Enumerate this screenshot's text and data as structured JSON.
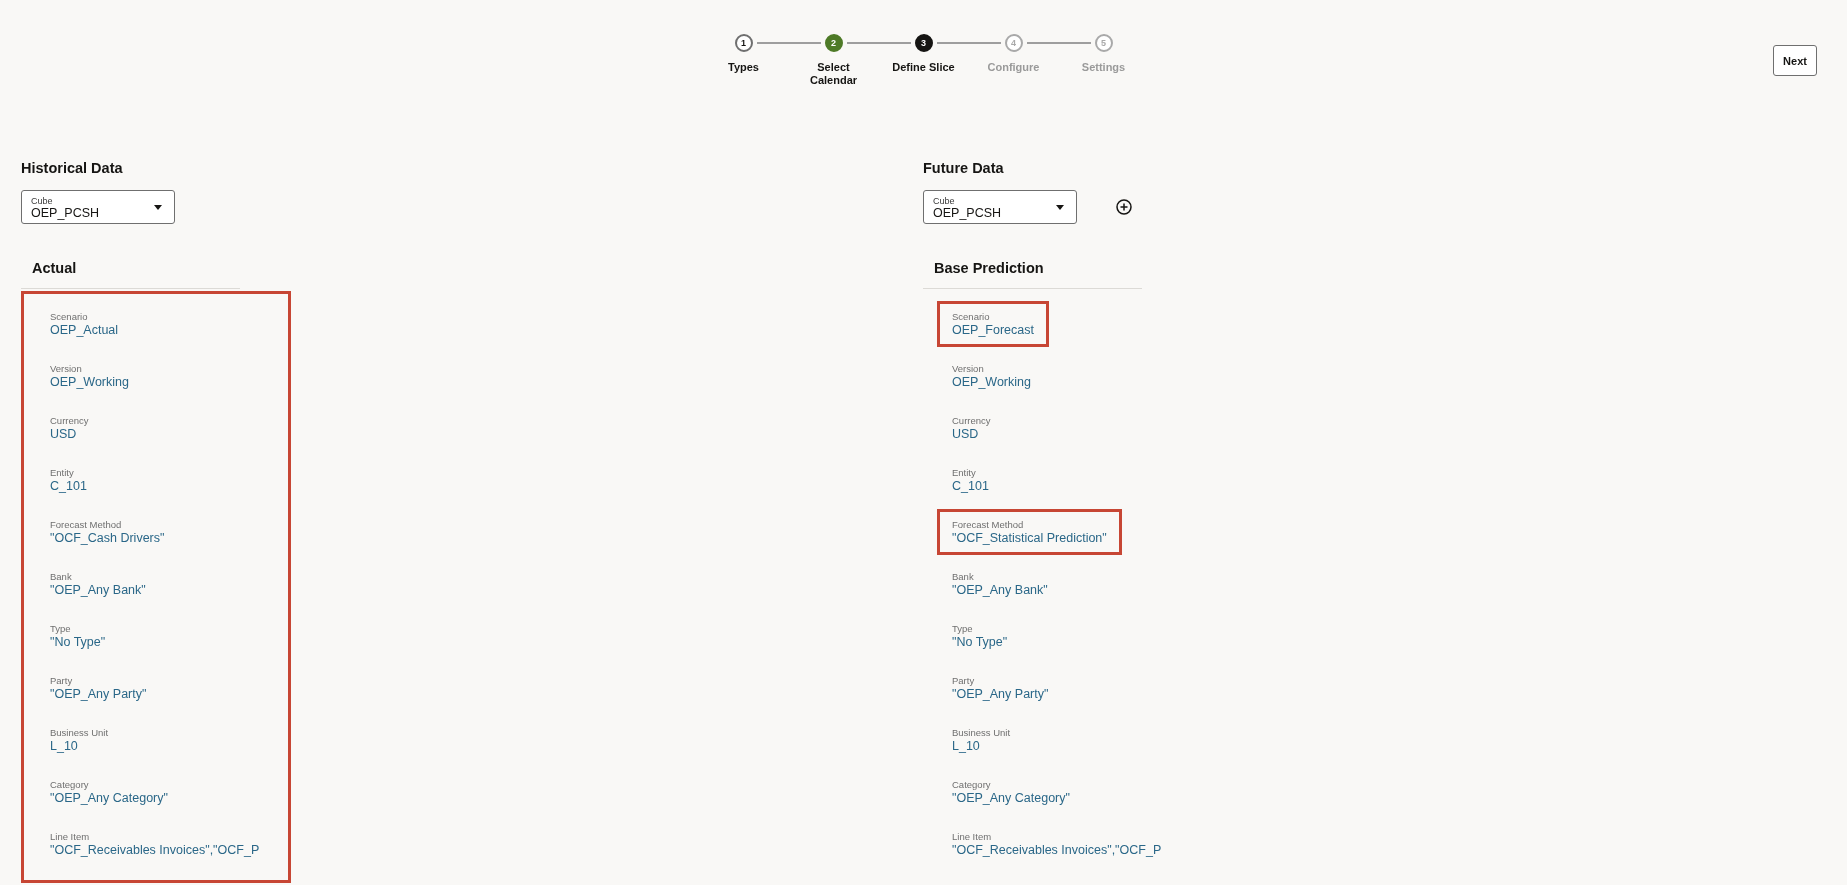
{
  "stepper": {
    "steps": [
      {
        "number": "1",
        "label": "Types",
        "kind": "done"
      },
      {
        "number": "2",
        "label": "Select Calendar",
        "kind": "visited"
      },
      {
        "number": "3",
        "label": "Define Slice",
        "kind": "current"
      },
      {
        "number": "4",
        "label": "Configure",
        "kind": "disabled"
      },
      {
        "number": "5",
        "label": "Settings",
        "kind": "disabled"
      }
    ]
  },
  "next_button": "Next",
  "sections": [
    {
      "title": "Historical Data",
      "cube": {
        "label": "Cube",
        "value": "OEP_PCSH"
      },
      "add_button": false,
      "panel": {
        "title": "Actual",
        "highlighted": true,
        "fields": [
          {
            "label": "Scenario",
            "value": "OEP_Actual",
            "highlighted": false
          },
          {
            "label": "Version",
            "value": "OEP_Working",
            "highlighted": false
          },
          {
            "label": "Currency",
            "value": "USD",
            "highlighted": false
          },
          {
            "label": "Entity",
            "value": "C_101",
            "highlighted": false
          },
          {
            "label": "Forecast Method",
            "value": "\"OCF_Cash Drivers\"",
            "highlighted": false
          },
          {
            "label": "Bank",
            "value": "\"OEP_Any Bank\"",
            "highlighted": false
          },
          {
            "label": "Type",
            "value": "\"No Type\"",
            "highlighted": false
          },
          {
            "label": "Party",
            "value": "\"OEP_Any Party\"",
            "highlighted": false
          },
          {
            "label": "Business Unit",
            "value": "L_10",
            "highlighted": false
          },
          {
            "label": "Category",
            "value": "\"OEP_Any Category\"",
            "highlighted": false
          },
          {
            "label": "Line Item",
            "value": "\"OCF_Receivables Invoices\",\"OCF_P",
            "highlighted": false
          }
        ]
      }
    },
    {
      "title": "Future Data",
      "cube": {
        "label": "Cube",
        "value": "OEP_PCSH"
      },
      "add_button": true,
      "panel": {
        "title": "Base Prediction",
        "highlighted": false,
        "fields": [
          {
            "label": "Scenario",
            "value": "OEP_Forecast",
            "highlighted": true
          },
          {
            "label": "Version",
            "value": "OEP_Working",
            "highlighted": false
          },
          {
            "label": "Currency",
            "value": "USD",
            "highlighted": false
          },
          {
            "label": "Entity",
            "value": "C_101",
            "highlighted": false
          },
          {
            "label": "Forecast Method",
            "value": "\"OCF_Statistical Prediction\"",
            "highlighted": true
          },
          {
            "label": "Bank",
            "value": "\"OEP_Any Bank\"",
            "highlighted": false
          },
          {
            "label": "Type",
            "value": "\"No Type\"",
            "highlighted": false
          },
          {
            "label": "Party",
            "value": "\"OEP_Any Party\"",
            "highlighted": false
          },
          {
            "label": "Business Unit",
            "value": "L_10",
            "highlighted": false
          },
          {
            "label": "Category",
            "value": "\"OEP_Any Category\"",
            "highlighted": false
          },
          {
            "label": "Line Item",
            "value": "\"OCF_Receivables Invoices\",\"OCF_P",
            "highlighted": false
          }
        ]
      }
    }
  ]
}
